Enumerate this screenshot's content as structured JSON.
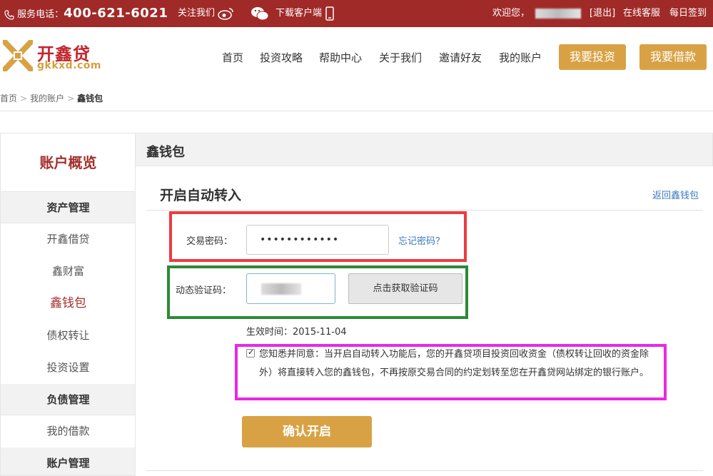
{
  "topbar": {
    "service_label": "服务电话：",
    "phone": "400-621-6021",
    "follow": "关注我们",
    "download": "下载客户端",
    "welcome": "欢迎您，",
    "logout": "[退出]",
    "online_service": "在线客服",
    "daily_checkin": "每日签到"
  },
  "header": {
    "logo_cn": "开鑫贷",
    "logo_en": "gkkxd.com",
    "nav": [
      "首页",
      "投资攻略",
      "帮助中心",
      "关于我们",
      "邀请好友",
      "我的账户"
    ],
    "invest_button": "我要投资",
    "borrow_button": "我要借款"
  },
  "breadcrumb": {
    "home": "首页",
    "account": "我的账户",
    "current": "鑫钱包"
  },
  "sidebar": {
    "title": "账户概览",
    "group_assets": "资产管理",
    "items_assets": [
      "开鑫借贷",
      "鑫财富",
      "鑫钱包",
      "债权转让",
      "投资设置"
    ],
    "group_debt": "负债管理",
    "items_debt": [
      "我的借款"
    ],
    "group_account": "账户管理"
  },
  "main": {
    "header_title": "鑫钱包",
    "section_title": "开启自动转入",
    "back_link": "返回鑫钱包",
    "password_label": "交易密码：",
    "password_value": "••••••••••••",
    "forgot_password": "忘记密码？",
    "code_label": "动态验证码：",
    "get_code_button": "点击获取验证码",
    "effective_date": "生效时间：2015-11-04",
    "agreement_checked": true,
    "agreement_text": "您知悉并同意：当开启自动转入功能后，您的开鑫贷项目投资回收资金（债权转让回收的资金除外）将直接转入您的鑫钱包，不再按原交易合同的约定划转至您在开鑫贷网站绑定的银行账户。",
    "confirm_button": "确认开启"
  },
  "colors": {
    "topbar": "#a02a28",
    "accent_gold": "#d8a244",
    "brand_red": "#a3302d",
    "link": "#3a7abf",
    "highlight_red": "#ee3a3f",
    "highlight_green": "#2b8a35",
    "highlight_pink": "#ea27e5"
  }
}
